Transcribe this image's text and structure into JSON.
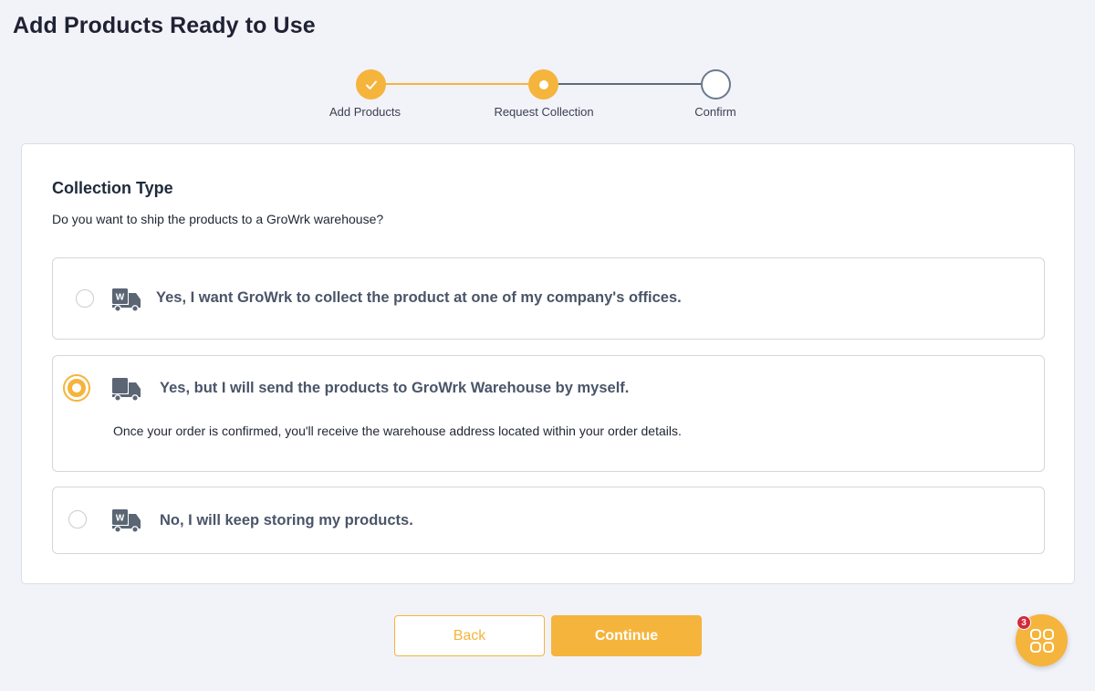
{
  "page": {
    "title": "Add Products Ready to Use"
  },
  "stepper": {
    "steps": [
      {
        "label": "Add Products",
        "state": "done",
        "icon": "check-icon"
      },
      {
        "label": "Request Collection",
        "state": "active",
        "icon": "dot-icon"
      },
      {
        "label": "Confirm",
        "state": "pending",
        "icon": ""
      }
    ]
  },
  "collection": {
    "title": "Collection Type",
    "question": "Do you want to ship the products to a GroWrk warehouse?",
    "options": [
      {
        "label": "Yes, I want GroWrk to collect the product at one of my company's offices.",
        "selected": false,
        "icon": "warehouse-truck-icon"
      },
      {
        "label": "Yes, but I will send the products to GroWrk Warehouse by myself.",
        "selected": true,
        "icon": "warehouse-truck-icon",
        "detail": "Once your order is confirmed, you'll receive the warehouse address located within your order details."
      },
      {
        "label": "No, I will keep storing my products.",
        "selected": false,
        "icon": "warehouse-truck-icon"
      }
    ]
  },
  "actions": {
    "back_label": "Back",
    "continue_label": "Continue"
  },
  "fab": {
    "badge_count": "3",
    "icon": "apps-grid-icon"
  },
  "colors": {
    "accent": "#f5b43c",
    "text_muted": "#4a5568",
    "badge": "#d22b3a",
    "background": "#f2f2f9"
  }
}
